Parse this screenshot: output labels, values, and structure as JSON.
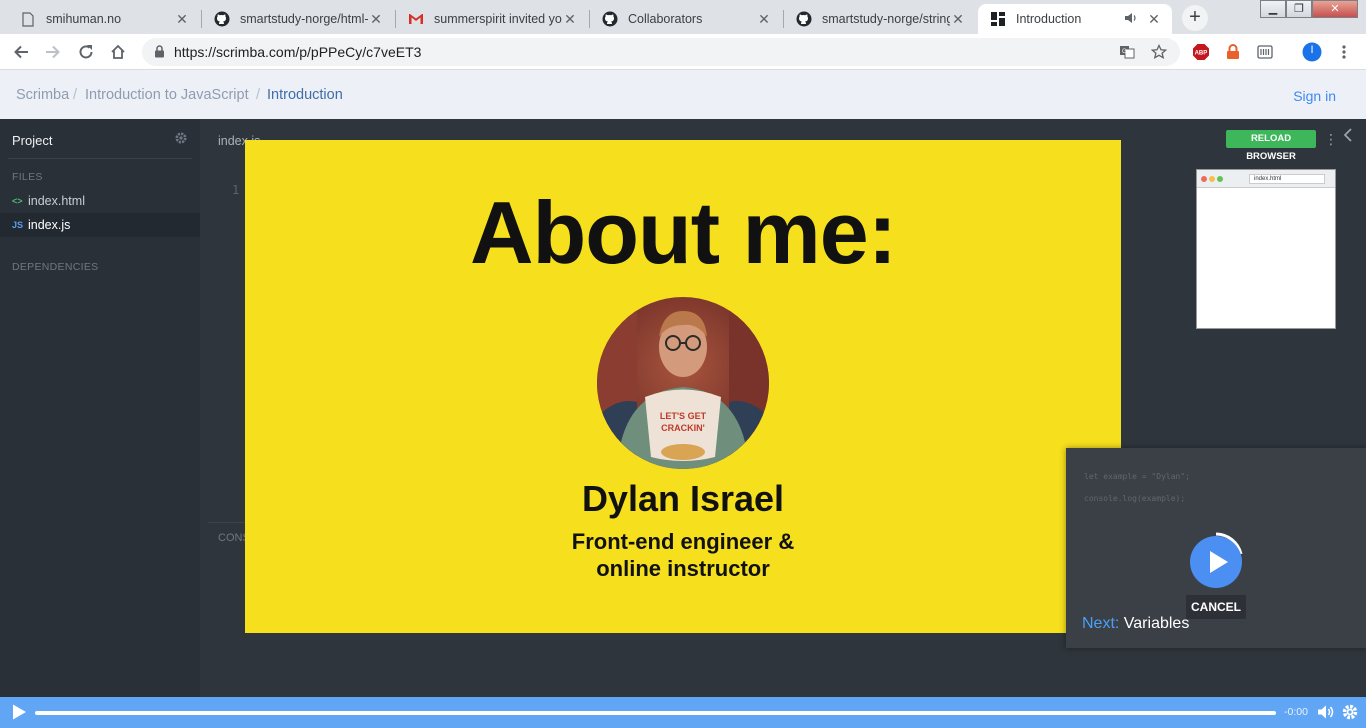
{
  "browser": {
    "tabs": [
      {
        "title": "smihuman.no",
        "icon": "page-icon"
      },
      {
        "title": "smartstudy-norge/html-",
        "icon": "github-icon"
      },
      {
        "title": "summerspirit invited you",
        "icon": "gmail-icon"
      },
      {
        "title": "Collaborators",
        "icon": "github-icon"
      },
      {
        "title": "smartstudy-norge/string",
        "icon": "github-icon"
      },
      {
        "title": "Introduction",
        "icon": "scrimba-icon",
        "active": true
      }
    ],
    "url": "https://scrimba.com/p/pPPeCy/c7veET3",
    "profile_initial": "I"
  },
  "scrimba": {
    "breadcrumb": [
      "Scrimba",
      "Introduction to JavaScript",
      "Introduction"
    ],
    "sign_in": "Sign in"
  },
  "sidebar": {
    "project_label": "Project",
    "files_label": "FILES",
    "files": [
      {
        "name": "index.html",
        "type": "html"
      },
      {
        "name": "index.js",
        "type": "js",
        "active": true
      }
    ],
    "dependencies_label": "DEPENDENCIES"
  },
  "editor": {
    "tab": "index.js",
    "line_number": "1",
    "console_label": "CONSOLE",
    "reload_label": "RELOAD BROWSER",
    "preview_url": "index.html"
  },
  "slide": {
    "title": "About me:",
    "name": "Dylan Israel",
    "role_line1": "Front-end engineer &",
    "role_line2": "online instructor",
    "shirt_text_1": "LET'S GET",
    "shirt_text_2": "CRACKIN'"
  },
  "next_popup": {
    "code_line1": "let example = \"Dylan\";",
    "code_line2": "console.log(example);",
    "cancel_label": "CANCEL",
    "next_label": "Next:",
    "next_title": "Variables"
  },
  "player": {
    "time": "-0:00",
    "progress": 0
  },
  "colors": {
    "slide_bg": "#f6df1d",
    "player_bg": "#61a6f5",
    "reload_green": "#3eb75b",
    "accent_blue": "#3d8af0"
  }
}
